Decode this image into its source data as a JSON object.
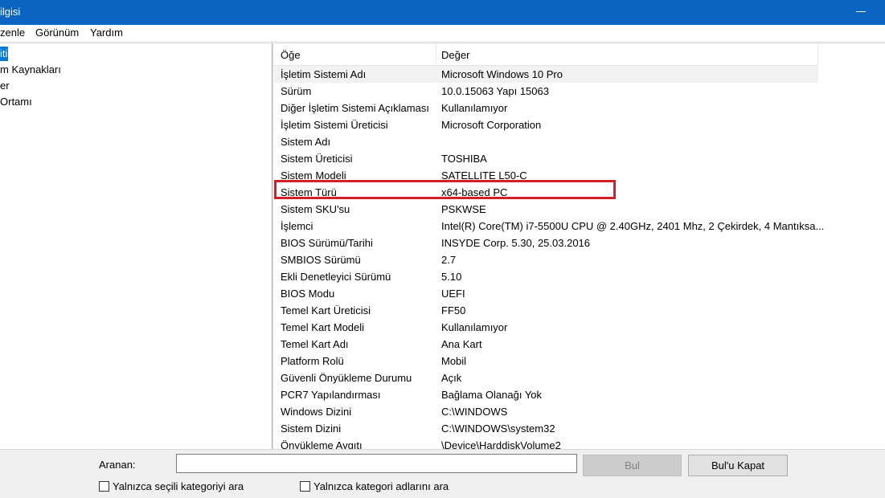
{
  "window": {
    "title": "ilgisi"
  },
  "menu": [
    "zenle",
    "Görünüm",
    "Yardım"
  ],
  "tree": {
    "selected": "iti",
    "items": [
      "m Kaynakları",
      "er",
      "Ortamı"
    ]
  },
  "list": {
    "columns": [
      "Öğe",
      "Değer"
    ],
    "rows": [
      [
        "İşletim Sistemi Adı",
        "Microsoft Windows 10 Pro"
      ],
      [
        "Sürüm",
        "10.0.15063 Yapı 15063"
      ],
      [
        "Diğer İşletim Sistemi Açıklaması",
        "Kullanılamıyor"
      ],
      [
        "İşletim Sistemi Üreticisi",
        "Microsoft Corporation"
      ],
      [
        "Sistem Adı",
        ""
      ],
      [
        "Sistem Üreticisi",
        "TOSHIBA"
      ],
      [
        "Sistem Modeli",
        "SATELLITE L50-C"
      ],
      [
        "Sistem Türü",
        "x64-based PC"
      ],
      [
        "Sistem SKU'su",
        "PSKWSE"
      ],
      [
        "İşlemci",
        "Intel(R) Core(TM) i7-5500U CPU @ 2.40GHz, 2401 Mhz, 2 Çekirdek, 4 Mantıksa..."
      ],
      [
        "BIOS Sürümü/Tarihi",
        "INSYDE Corp. 5.30, 25.03.2016"
      ],
      [
        "SMBIOS Sürümü",
        "2.7"
      ],
      [
        "Ekli Denetleyici Sürümü",
        "5.10"
      ],
      [
        "BIOS Modu",
        "UEFI"
      ],
      [
        "Temel Kart Üreticisi",
        "FF50"
      ],
      [
        "Temel Kart Modeli",
        "Kullanılamıyor"
      ],
      [
        "Temel Kart Adı",
        "Ana Kart"
      ],
      [
        "Platform Rolü",
        "Mobil"
      ],
      [
        "Güvenli Önyükleme Durumu",
        "Açık"
      ],
      [
        "PCR7 Yapılandırması",
        "Bağlama Olanağı Yok"
      ],
      [
        "Windows Dizini",
        "C:\\WINDOWS"
      ],
      [
        "Sistem Dizini",
        "C:\\WINDOWS\\system32"
      ],
      [
        "Önyükleme Aygıtı",
        "\\Device\\HarddiskVolume2"
      ]
    ]
  },
  "search": {
    "label": "Aranan:",
    "value": "",
    "find_button": "Bul",
    "close_button": "Bul'u Kapat",
    "option_selected_category": "Yalnızca seçili kategoriyi ara",
    "option_category_names": "Yalnızca kategori adlarını ara"
  },
  "colors": {
    "accent": "#0a64c2",
    "highlight": "#d32027"
  }
}
